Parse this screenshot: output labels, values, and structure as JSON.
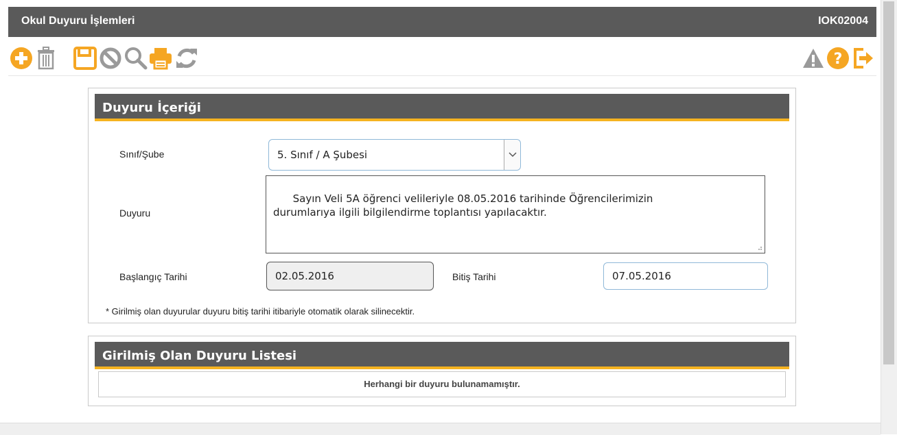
{
  "window": {
    "title": "Okul Duyuru İşlemleri",
    "code": "IOK02004"
  },
  "toolbar": {
    "icons": [
      "add-icon",
      "trash-icon",
      "save-icon",
      "cancel-icon",
      "search-icon",
      "print-icon",
      "refresh-icon",
      "warning-icon",
      "help-icon",
      "exit-icon"
    ],
    "colors": {
      "orange": "#f5a623",
      "gray": "#9a9a9a"
    }
  },
  "content_panel": {
    "title": "Duyuru İçeriği",
    "class_label": "Sınıf/Şube",
    "class_value": "5. Sınıf / A Şubesi",
    "announcement_label": "Duyuru",
    "announcement_text": "Sayın Veli 5A öğrenci velileriyle 08.05.2016 tarihinde Öğrencilerimizin\ndurumlarıya ilgili bilgilendirme toplantısı yapılacaktır.",
    "start_date_label": "Başlangıç Tarihi",
    "start_date_value": "02.05.2016",
    "end_date_label": "Bitiş Tarihi",
    "end_date_value": "07.05.2016",
    "note": "* Girilmiş olan duyurular duyuru bitiş tarihi itibariyle otomatik olarak silinecektir."
  },
  "list_panel": {
    "title": "Girilmiş Olan Duyuru Listesi",
    "empty_message": "Herhangi bir duyuru bulunamamıştır."
  },
  "theme": {
    "header_bg": "#5a5a5a",
    "accent": "#f5b320"
  }
}
